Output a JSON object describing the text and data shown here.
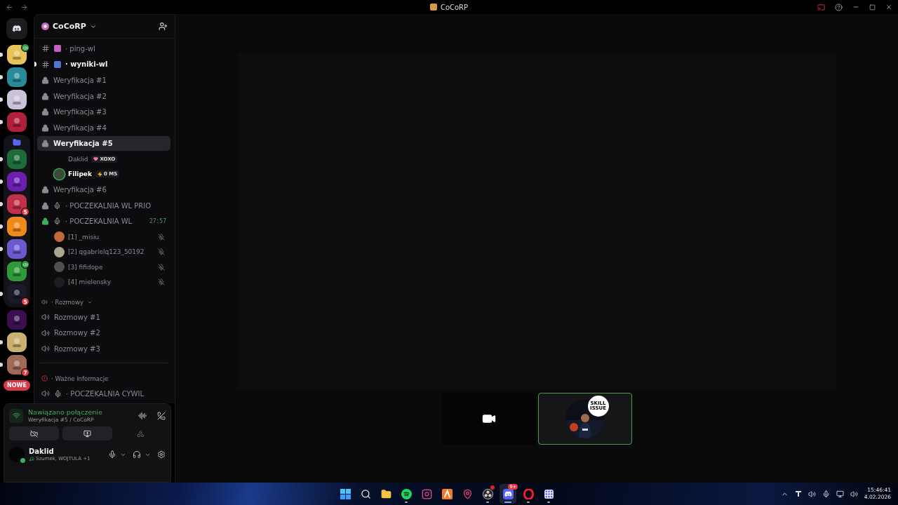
{
  "window": {
    "title": "CoCoRP"
  },
  "servers": [
    {
      "kind": "server",
      "color": "#e8c25a",
      "unread": true,
      "voice": true
    },
    {
      "kind": "server",
      "color": "#2a8a9a",
      "unread": true
    },
    {
      "kind": "server",
      "color": "#c9c2d8",
      "unread": true
    },
    {
      "kind": "server",
      "color": "#b0203a",
      "unread": true
    },
    {
      "kind": "folder",
      "color": "#5865f2",
      "children": [
        {
          "kind": "server",
          "color": "#1d6b3a",
          "unread": true
        },
        {
          "kind": "server",
          "color": "#6a1fb0",
          "unread": true
        },
        {
          "kind": "server",
          "color": "#c0304a",
          "unread": true,
          "badge": "5"
        },
        {
          "kind": "server",
          "color": "#f08a1a",
          "unread": true
        },
        {
          "kind": "server",
          "color": "#6a5acd",
          "unread": true
        },
        {
          "kind": "server",
          "color": "#2f9a3a",
          "unread": false,
          "voice": true
        },
        {
          "kind": "server",
          "color": "#1a1a2a",
          "unread": true,
          "badge": "5"
        }
      ]
    },
    {
      "kind": "server",
      "color": "#3a1050",
      "unread": false
    },
    {
      "kind": "server",
      "color": "#c8b070",
      "unread": true
    },
    {
      "kind": "server",
      "color": "#a06a5a",
      "unread": true,
      "badge": "7"
    }
  ],
  "new_label": "NOWE",
  "server_name": "CoCoRP",
  "channels": [
    {
      "kind": "text",
      "name": "· ping-wl",
      "selected": false,
      "unread": false
    },
    {
      "kind": "text",
      "name": "· wyniki-wl",
      "selected": false,
      "unread": true
    },
    {
      "kind": "private",
      "name": "Weryfikacja #1",
      "selected": false,
      "unread": false
    },
    {
      "kind": "private",
      "name": "Weryfikacja #2",
      "selected": false,
      "unread": false
    },
    {
      "kind": "private",
      "name": "Weryfikacja #3",
      "selected": false,
      "unread": false
    },
    {
      "kind": "private",
      "name": "Weryfikacja #4",
      "selected": false,
      "unread": false
    },
    {
      "kind": "private",
      "name": "Weryfikacja #5",
      "selected": true,
      "unread": false,
      "members": [
        {
          "name": "Daklid",
          "speaking": false,
          "muted": false,
          "tag": {
            "kind": "heart",
            "text": "XOXO"
          }
        },
        {
          "name": "Filipek",
          "speaking": true,
          "muted": false,
          "color": "#3a4a3a",
          "tag": {
            "kind": "bolt",
            "text": "0 MS"
          }
        }
      ]
    },
    {
      "kind": "private",
      "name": "Weryfikacja #6",
      "selected": false,
      "unread": false
    },
    {
      "kind": "private-stage",
      "name": "· POCZEKALNIA WL PRIO",
      "selected": false,
      "unread": false
    },
    {
      "kind": "private-stage",
      "name": "· POCZEKALNIA WL",
      "selected": false,
      "unread": false,
      "accessible": true,
      "timer": "27:57",
      "members": [
        {
          "name": "[1] _misiu",
          "speaking": false,
          "muted": true,
          "color": "#c06a3a"
        },
        {
          "name": "[2] qgabrielq123_50192",
          "speaking": false,
          "muted": true,
          "color": "#a8a890"
        },
        {
          "name": "[3] fifidope",
          "speaking": false,
          "muted": true,
          "color": "#505050"
        },
        {
          "name": "[4] mielensky",
          "speaking": false,
          "muted": true,
          "color": "#1e1e22"
        }
      ]
    },
    {
      "kind": "voice-category",
      "name": "· Rozmowy"
    },
    {
      "kind": "voice",
      "name": "Rozmowy #1",
      "selected": false,
      "unread": false
    },
    {
      "kind": "voice",
      "name": "Rozmowy #2",
      "selected": false,
      "unread": false
    },
    {
      "kind": "voice",
      "name": "Rozmowy #3",
      "selected": false,
      "unread": false
    },
    {
      "kind": "divider"
    },
    {
      "kind": "alert-category",
      "name": "· Ważne informacje"
    },
    {
      "kind": "voice-stage",
      "name": "· POCZEKALNIA CYWIL",
      "selected": false,
      "unread": false
    }
  ],
  "voice_panel": {
    "status": "Nawiązano połączenie",
    "channel": "Weryfikacja #5 / CoCoRP",
    "buttons": [
      {
        "kind": "camera",
        "disabled": false
      },
      {
        "kind": "screen",
        "disabled": false
      },
      {
        "kind": "activities",
        "disabled": true
      }
    ]
  },
  "user": {
    "name": "Daklid",
    "activity": "Szumek, WOJTULA +1",
    "online": true
  },
  "tiles": [
    {
      "kind": "camera",
      "speaking": false
    },
    {
      "kind": "stream",
      "speaking": true,
      "sticker": "SKILL ISSUE"
    }
  ],
  "taskbar": [
    {
      "kind": "start",
      "running": false,
      "active": false
    },
    {
      "kind": "search",
      "running": false,
      "active": false
    },
    {
      "kind": "folder",
      "running": false,
      "active": false
    },
    {
      "kind": "spotify",
      "running": true,
      "active": false
    },
    {
      "kind": "instagram",
      "running": false,
      "active": false
    },
    {
      "kind": "tool",
      "running": false,
      "active": false
    },
    {
      "kind": "pin",
      "running": false,
      "active": false
    },
    {
      "kind": "obs",
      "running": true,
      "active": false,
      "dot": true
    },
    {
      "kind": "discord",
      "running": true,
      "active": true,
      "badge": "9+"
    },
    {
      "kind": "opera",
      "running": true,
      "active": false
    },
    {
      "kind": "grid",
      "running": true,
      "active": false
    }
  ],
  "clock": {
    "time": "15:46:41",
    "date": "4.02.2026"
  }
}
